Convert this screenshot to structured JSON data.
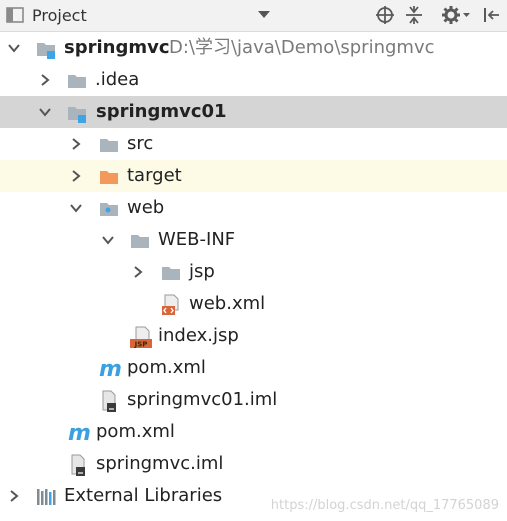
{
  "panel": {
    "view_label": "Project",
    "watermark": "https://blog.csdn.net/qq_17765089"
  },
  "toolbar": {
    "icons": [
      "target-icon",
      "collapse-all-icon",
      "gear-icon",
      "hide-panel-icon"
    ]
  },
  "tree": {
    "root_name": "springmvc",
    "root_path": "D:\\学习\\java\\Demo\\springmvc",
    "idea": ".idea",
    "module_name": "springmvc01",
    "src": "src",
    "target": "target",
    "web": "web",
    "webinf": "WEB-INF",
    "jsp": "jsp",
    "webxml": "web.xml",
    "indexjsp": "index.jsp",
    "module_pom": "pom.xml",
    "module_iml": "springmvc01.iml",
    "root_pom": "pom.xml",
    "root_iml": "springmvc.iml",
    "external_libraries": "External Libraries"
  },
  "colors": {
    "folder": "#a9b4bd",
    "target_folder": "#f2995b",
    "module_dot": "#3fa4e6",
    "maven_blue": "#3aa0e0",
    "selection": "#d5d5d5",
    "hover": "#fdfbe6",
    "xml_red": "#d9663a"
  }
}
